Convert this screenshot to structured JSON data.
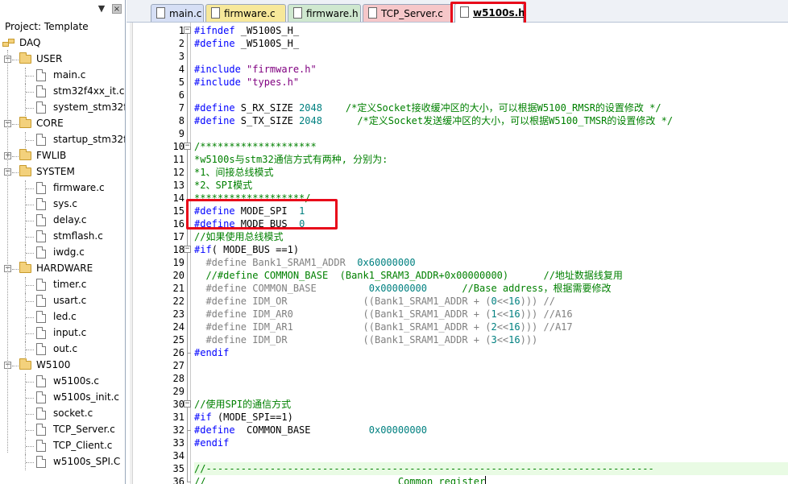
{
  "project_panel": {
    "title": "Project: Template",
    "pin_icon": "pin-icon",
    "close_icon": "close-icon",
    "tree": [
      {
        "label": "DAQ",
        "kind": "root",
        "level": 0
      },
      {
        "label": "USER",
        "kind": "folder",
        "level": 1,
        "expanded": true
      },
      {
        "label": "main.c",
        "kind": "file",
        "level": 2
      },
      {
        "label": "stm32f4xx_it.c",
        "kind": "file",
        "level": 2
      },
      {
        "label": "system_stm32f4xx.c",
        "kind": "file",
        "level": 2
      },
      {
        "label": "CORE",
        "kind": "folder",
        "level": 1,
        "expanded": true
      },
      {
        "label": "startup_stm32f40_41xxx.s",
        "kind": "file",
        "level": 2
      },
      {
        "label": "FWLIB",
        "kind": "folder",
        "level": 1,
        "expanded": false
      },
      {
        "label": "SYSTEM",
        "kind": "folder",
        "level": 1,
        "expanded": true
      },
      {
        "label": "firmware.c",
        "kind": "file",
        "level": 2
      },
      {
        "label": "sys.c",
        "kind": "file",
        "level": 2
      },
      {
        "label": "delay.c",
        "kind": "file",
        "level": 2
      },
      {
        "label": "stmflash.c",
        "kind": "file",
        "level": 2
      },
      {
        "label": "iwdg.c",
        "kind": "file",
        "level": 2
      },
      {
        "label": "HARDWARE",
        "kind": "folder",
        "level": 1,
        "expanded": true
      },
      {
        "label": "timer.c",
        "kind": "file",
        "level": 2
      },
      {
        "label": "usart.c",
        "kind": "file",
        "level": 2
      },
      {
        "label": "led.c",
        "kind": "file",
        "level": 2
      },
      {
        "label": "input.c",
        "kind": "file",
        "level": 2
      },
      {
        "label": "out.c",
        "kind": "file",
        "level": 2
      },
      {
        "label": "W5100",
        "kind": "folder",
        "level": 1,
        "expanded": true
      },
      {
        "label": "w5100s.c",
        "kind": "file",
        "level": 2
      },
      {
        "label": "w5100s_init.c",
        "kind": "file",
        "level": 2
      },
      {
        "label": "socket.c",
        "kind": "file",
        "level": 2
      },
      {
        "label": "TCP_Server.c",
        "kind": "file",
        "level": 2
      },
      {
        "label": "TCP_Client.c",
        "kind": "file",
        "level": 2
      },
      {
        "label": "w5100s_SPI.C",
        "kind": "file",
        "level": 2
      }
    ]
  },
  "tabs": [
    {
      "label": "main.c",
      "color": "#d6dff5",
      "active": false
    },
    {
      "label": "firmware.c",
      "color": "#f7e89a",
      "active": false
    },
    {
      "label": "firmware.h",
      "color": "#cfe8cf",
      "active": false
    },
    {
      "label": "TCP_Server.c",
      "color": "#f6c7c9",
      "active": false
    },
    {
      "label": "w5100s.h",
      "color": "#e6dcf7",
      "active": true
    }
  ],
  "editor": {
    "first_line_number": 1,
    "active_line": 35,
    "lines": [
      [
        [
          "#ifndef",
          "pp"
        ],
        [
          " _W5100S_H_",
          "pl"
        ]
      ],
      [
        [
          "#define",
          "pp"
        ],
        [
          " _W5100S_H_",
          "pl"
        ]
      ],
      [],
      [
        [
          "#include",
          "pp"
        ],
        [
          " ",
          "pl"
        ],
        [
          "\"firmware.h\"",
          "str"
        ]
      ],
      [
        [
          "#include",
          "pp"
        ],
        [
          " ",
          "pl"
        ],
        [
          "\"types.h\"",
          "str"
        ]
      ],
      [],
      [
        [
          "#define",
          "pp"
        ],
        [
          " S_RX_SIZE ",
          "pl"
        ],
        [
          "2048",
          "num"
        ],
        [
          "    ",
          "pl"
        ],
        [
          "/*定义Socket接收缓冲区的大小，可以根据W5100_RMSR的设置修改 */",
          "cm"
        ]
      ],
      [
        [
          "#define",
          "pp"
        ],
        [
          " S_TX_SIZE ",
          "pl"
        ],
        [
          "2048",
          "num"
        ],
        [
          "      ",
          "pl"
        ],
        [
          "/*定义Socket发送缓冲区的大小，可以根据W5100_TMSR的设置修改 */",
          "cm"
        ]
      ],
      [],
      [
        [
          "/********************",
          "cm"
        ]
      ],
      [
        [
          "*w5100s与stm32通信方式有两种, 分别为:",
          "cm"
        ]
      ],
      [
        [
          "*1、间接总线模式",
          "cm"
        ]
      ],
      [
        [
          "*2、SPI模式",
          "cm"
        ]
      ],
      [
        [
          "*******************/",
          "cm"
        ]
      ],
      [
        [
          "#define",
          "pp"
        ],
        [
          " MODE_SPI  ",
          "pl"
        ],
        [
          "1",
          "num"
        ]
      ],
      [
        [
          "#define",
          "pp"
        ],
        [
          " MODE_BUS  ",
          "pl"
        ],
        [
          "0",
          "num"
        ]
      ],
      [
        [
          "//如果使用总线模式",
          "cm"
        ]
      ],
      [
        [
          "#if",
          "pp"
        ],
        [
          "( MODE_BUS ==1)",
          "pl"
        ]
      ],
      [
        [
          "  #define Bank1_SRAM1_ADDR  ",
          "gray"
        ],
        [
          "0x60000000",
          "num"
        ]
      ],
      [
        [
          "  //#define COMMON_BASE  (Bank1_SRAM3_ADDR+0x00000000)      //地址数据线复用",
          "cm"
        ]
      ],
      [
        [
          "  #define COMMON_BASE         ",
          "gray"
        ],
        [
          "0x00000000",
          "num"
        ],
        [
          "      ",
          "gray"
        ],
        [
          "//Base address，根据需要修改",
          "cm"
        ]
      ],
      [
        [
          "  #define IDM_OR             ((Bank1_SRAM1_ADDR + (",
          "gray"
        ],
        [
          "0",
          "num"
        ],
        [
          "<<",
          "gray"
        ],
        [
          "16",
          "num"
        ],
        [
          "))) //",
          "gray"
        ]
      ],
      [
        [
          "  #define IDM_AR0            ((Bank1_SRAM1_ADDR + (",
          "gray"
        ],
        [
          "1",
          "num"
        ],
        [
          "<<",
          "gray"
        ],
        [
          "16",
          "num"
        ],
        [
          "))) //A16",
          "gray"
        ]
      ],
      [
        [
          "  #define IDM_AR1            ((Bank1_SRAM1_ADDR + (",
          "gray"
        ],
        [
          "2",
          "num"
        ],
        [
          "<<",
          "gray"
        ],
        [
          "16",
          "num"
        ],
        [
          "))) //A17",
          "gray"
        ]
      ],
      [
        [
          "  #define IDM_DR             ((Bank1_SRAM1_ADDR + (",
          "gray"
        ],
        [
          "3",
          "num"
        ],
        [
          "<<",
          "gray"
        ],
        [
          "16",
          "num"
        ],
        [
          ")))",
          "gray"
        ]
      ],
      [
        [
          "#endif",
          "pp"
        ]
      ],
      [],
      [],
      [],
      [
        [
          "//使用SPI的通信方式",
          "cm"
        ]
      ],
      [
        [
          "#if",
          "pp"
        ],
        [
          " (MODE_SPI==1)",
          "pl"
        ]
      ],
      [
        [
          "#define",
          "pp"
        ],
        [
          "  COMMON_BASE          ",
          "pl"
        ],
        [
          "0x00000000",
          "num"
        ]
      ],
      [
        [
          "#endif",
          "pp"
        ]
      ],
      [],
      [
        [
          "//-----------------------------------------------------------------------------",
          "cm"
        ]
      ],
      [
        [
          "//                                 Common register",
          "cm"
        ],
        [
          "",
          "cursor"
        ]
      ],
      [
        [
          "//-----------------------------------------------------------------------------",
          "cm"
        ]
      ]
    ]
  },
  "colors": {
    "preprocessor": "#0000ff",
    "string": "#800080",
    "number": "#008080",
    "comment": "#008000",
    "disabled_code": "#808080",
    "highlight_box": "#e8091a",
    "active_line_bg": "#e9fbe4"
  }
}
